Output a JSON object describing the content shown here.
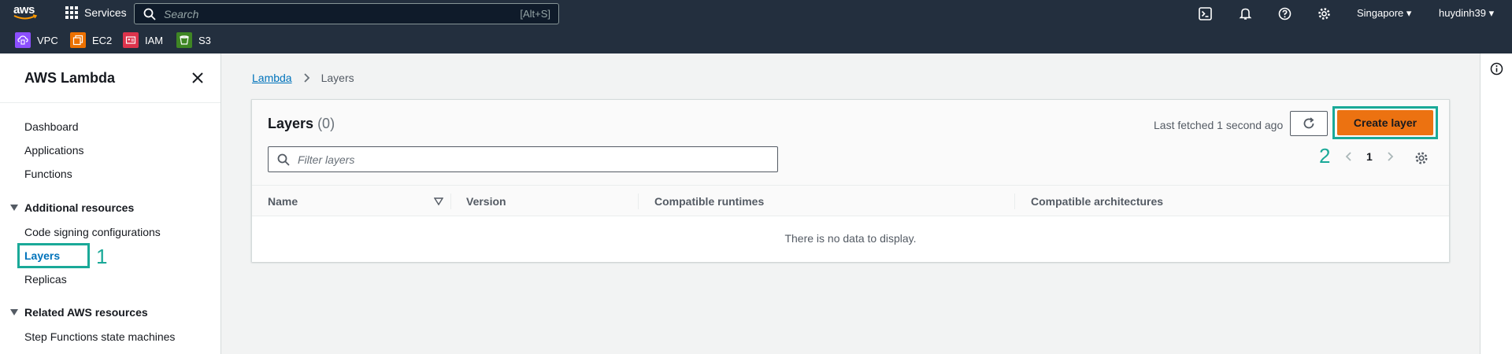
{
  "topnav": {
    "logo_text": "aws",
    "services_label": "Services",
    "search_placeholder": "Search",
    "search_shortcut": "[Alt+S]",
    "region": "Singapore ▾",
    "user": "huydinh39 ▾",
    "icons": [
      "cloudshell-icon",
      "bell-icon",
      "help-icon",
      "settings-icon"
    ]
  },
  "favorites": [
    {
      "label": "VPC",
      "color": "#8c4fff"
    },
    {
      "label": "EC2",
      "color": "#ed7100"
    },
    {
      "label": "IAM",
      "color": "#dd344c"
    },
    {
      "label": "S3",
      "color": "#3f8624"
    }
  ],
  "sidebar": {
    "title": "AWS Lambda",
    "items": [
      "Dashboard",
      "Applications",
      "Functions"
    ],
    "section1": "Additional resources",
    "section1_items": [
      "Code signing configurations",
      "Layers",
      "Replicas"
    ],
    "section2": "Related AWS resources",
    "section2_items": [
      "Step Functions state machines"
    ],
    "annotation": "1"
  },
  "breadcrumb": {
    "parent": "Lambda",
    "current": "Layers"
  },
  "layers": {
    "title": "Layers",
    "count": "(0)",
    "last_fetched": "Last fetched 1 second ago",
    "create_label": "Create layer",
    "filter_placeholder": "Filter layers",
    "annotation": "2",
    "page": "1",
    "columns": [
      "Name",
      "Version",
      "Compatible runtimes",
      "Compatible architectures"
    ],
    "empty_text": "There is no data to display."
  },
  "colors": {
    "accent": "#ec7211",
    "link": "#0073bb",
    "highlight": "#1aa998",
    "nav": "#232f3e"
  }
}
